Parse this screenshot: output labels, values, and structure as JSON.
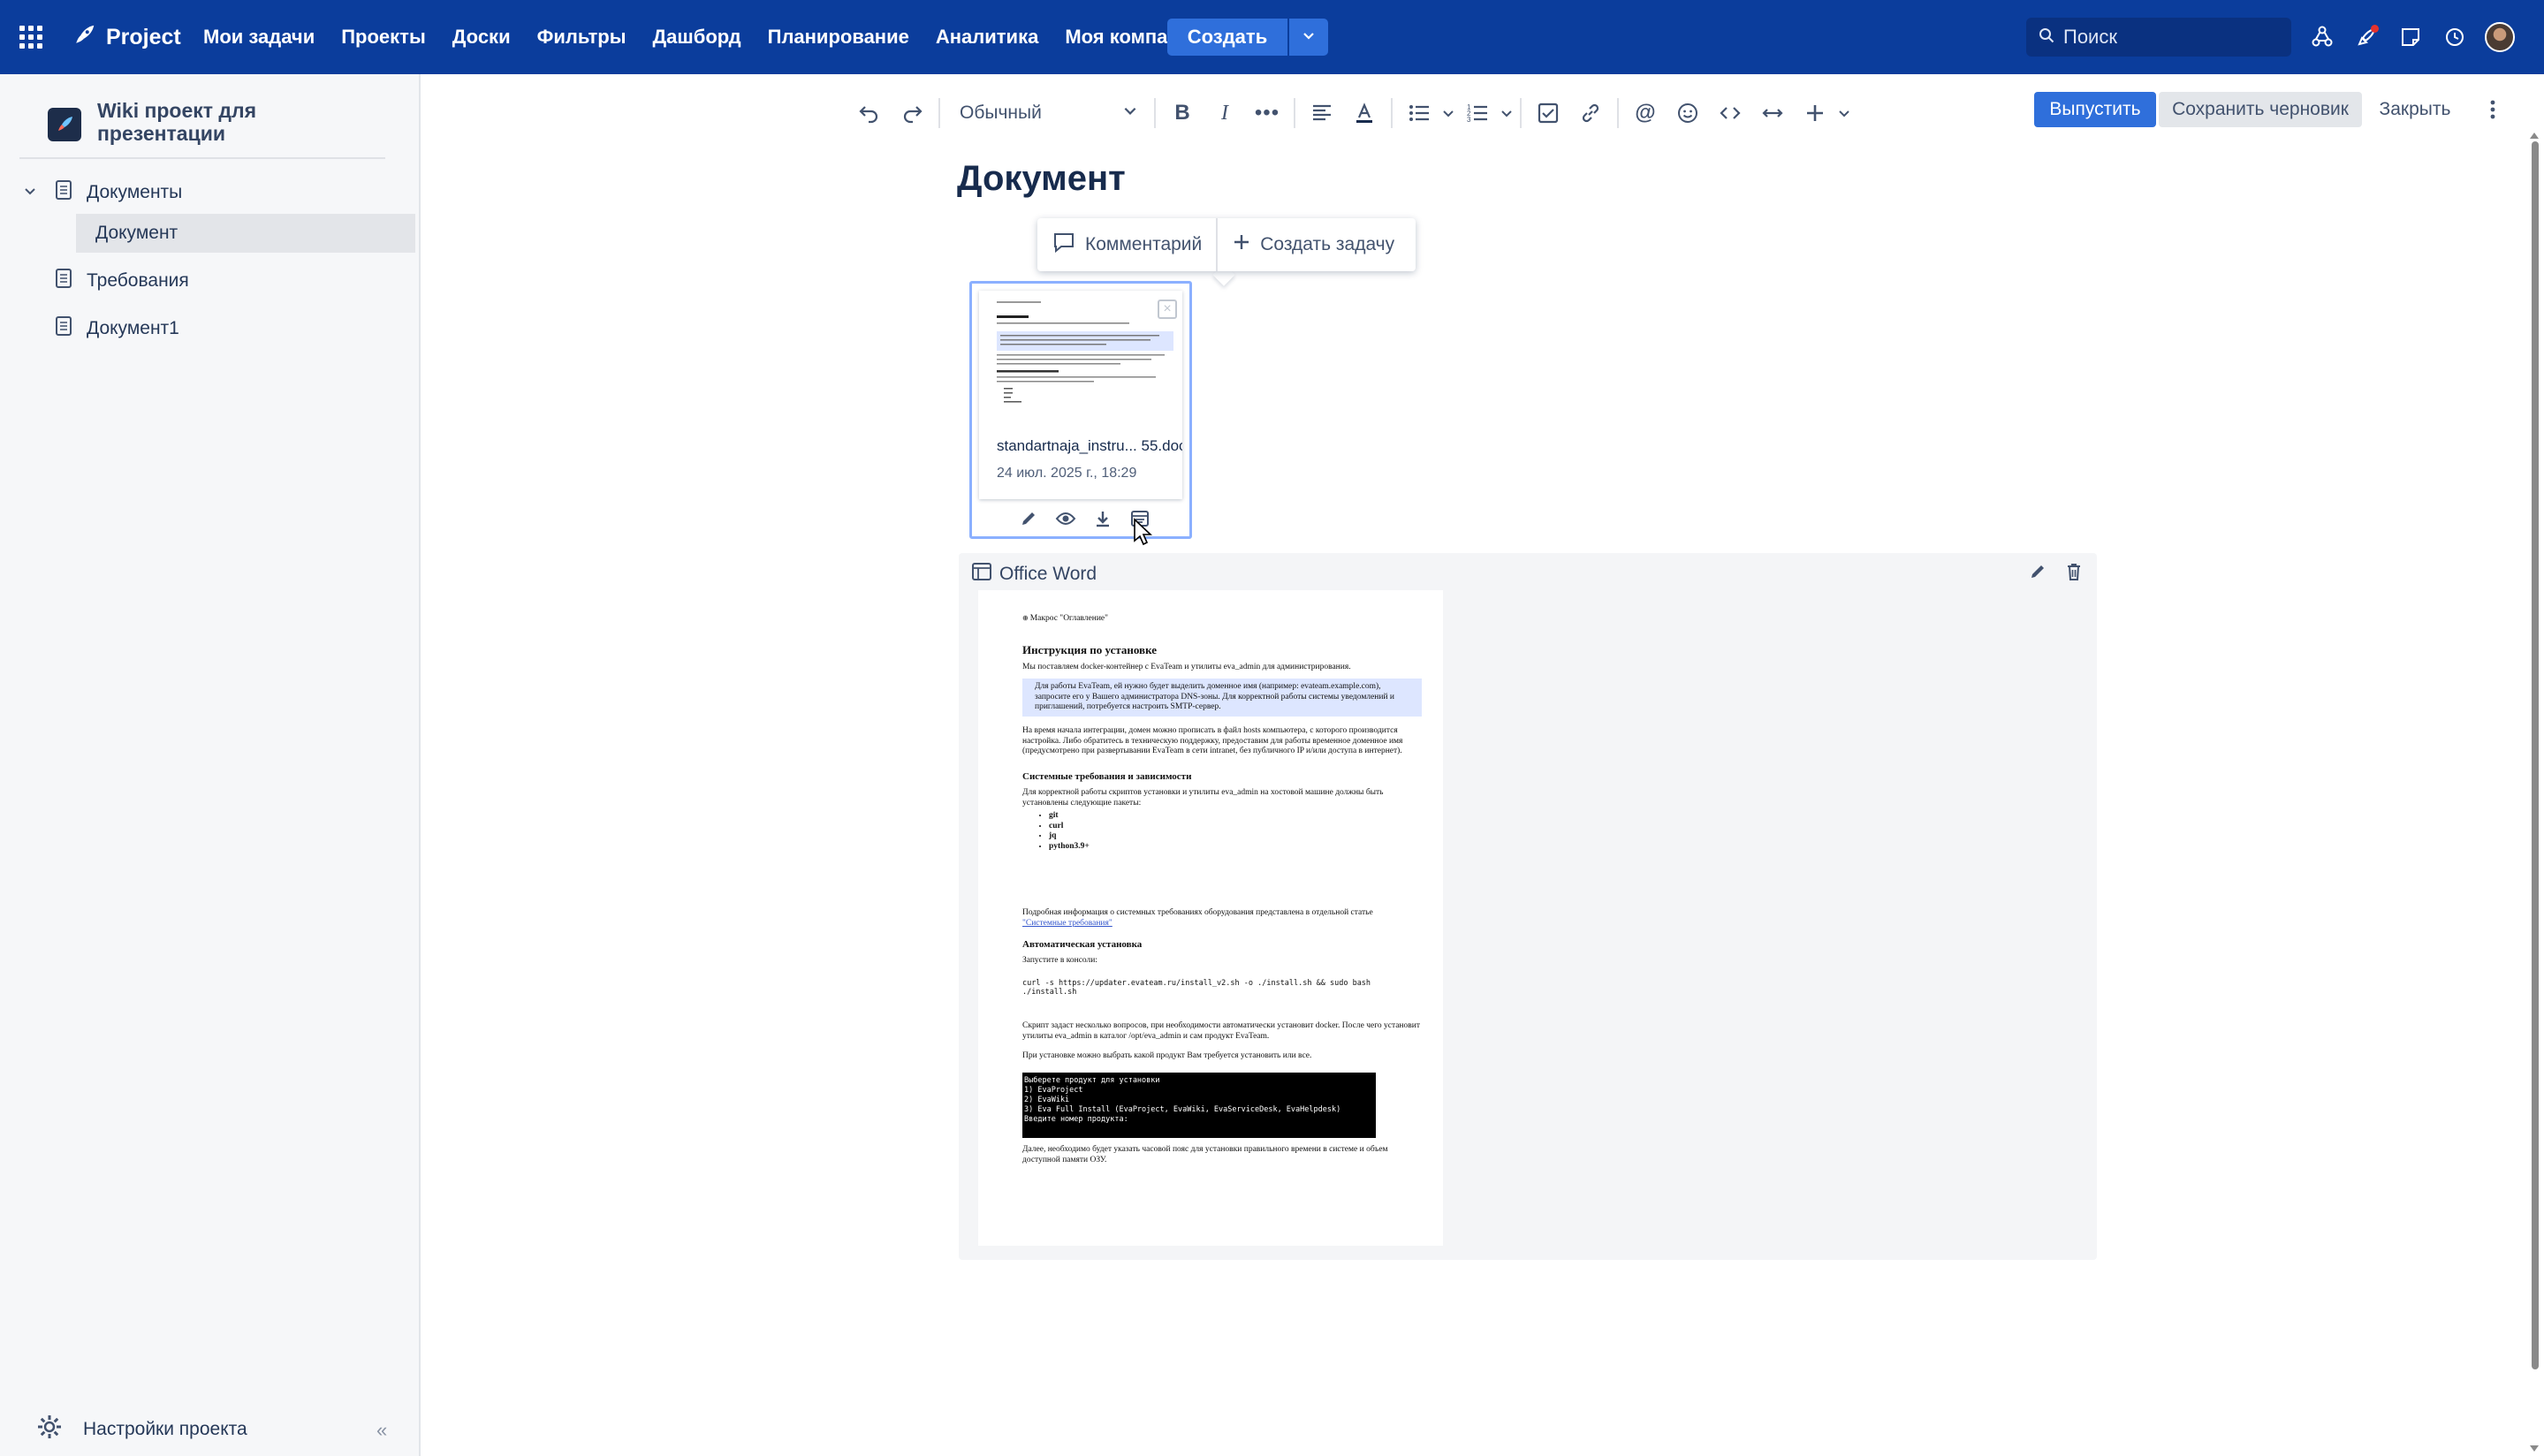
{
  "topbar": {
    "app_name": "Project",
    "nav": [
      "Мои задачи",
      "Проекты",
      "Доски",
      "Фильтры",
      "Дашборд",
      "Планирование",
      "Аналитика",
      "Моя компания"
    ],
    "create_label": "Создать",
    "search_placeholder": "Поиск"
  },
  "sidebar": {
    "project_title": "Wiki проект для презентации",
    "tree": [
      {
        "label": "Документы",
        "expanded": true
      },
      {
        "label": "Документ",
        "selected": true
      },
      {
        "label": "Требования"
      },
      {
        "label": "Документ1"
      }
    ],
    "settings_label": "Настройки проекта"
  },
  "editor": {
    "style_select": "Обычный",
    "publish_label": "Выпустить",
    "save_draft_label": "Сохранить черновик",
    "close_label": "Закрыть",
    "doc_title": "Документ",
    "float_toolbar": {
      "comment_label": "Комментарий",
      "create_task_label": "Создать задачу"
    },
    "attachment": {
      "file_name": "standartnaja_instru... 55.doc",
      "date": "24 июл. 2025 г., 18:29"
    },
    "macro": {
      "title": "Office Word",
      "page": {
        "toc": "Макрос \"Оглавление\"",
        "h1": "Инструкция по установке",
        "intro": "Мы поставляем docker-контейнер с EvaTeam и утилиты eva_admin для администрирования.",
        "note": "Для работы EvaTeam, ей нужно будет выделить доменное имя (например: evateam.example.com), запросите его у Вашего администратора DNS-зоны. Для корректной работы системы уведомлений и приглашений, потребуется настроить SMTP-сервер.",
        "p1": "На время начала интеграции, домен можно прописать в файл hosts компьютера, с которого производится настройка. Либо обратитесь в техническую поддержку, предоставим для работы временное доменное имя (предусмотрено при развертывании EvaTeam в сети intranet, без публичного IP и/или доступа в интернет).",
        "h2": "Системные требования и зависимости",
        "p2": "Для корректной работы скриптов установки и утилиты eva_admin на хостовой машине должны быть установлены следующие пакеты:",
        "packages": [
          "git",
          "curl",
          "jq",
          "python3.9+"
        ],
        "p3": "Подробная информация о системных требованиях оборудования представлена в отдельной статье",
        "p3_link": "\"Системные требования\"",
        "h3": "Автоматическая установка",
        "p4": "Запустите в консоли:",
        "cmd": "curl -s https://updater.evateam.ru/install_v2.sh -o ./install.sh && sudo bash ./install.sh",
        "p5": "Скрипт задаст несколько вопросов, при необходимости автоматически установит docker. После чего установит утилиты eva_admin в каталог /opt/eva_admin и сам продукт EvaTeam.",
        "p6": "При установке можно выбрать какой продукт Вам требуется установить или все.",
        "terminal": [
          "Выберете продукт для установки",
          "1) EvaProject",
          "2) EvaWiki",
          "3) Eva Full Install (EvaProject, EvaWiki, EvaServiceDesk, EvaHelpdesk)",
          "Введите номер продукта:"
        ],
        "p7": "Далее, необходимо будет указать часовой пояс для установки правильного времени в системе и объем доступной памяти ОЗУ."
      }
    }
  },
  "colors": {
    "topbar_bg": "#0b3d9c",
    "primary": "#2f6fdb",
    "sidebar_bg": "#f6f7f9",
    "selection_border": "#8bb0ff"
  }
}
